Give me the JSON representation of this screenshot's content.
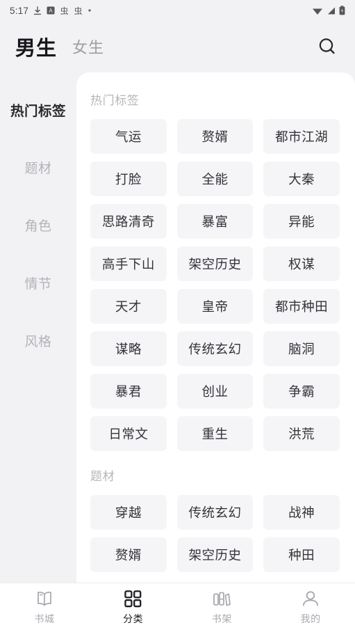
{
  "statusbar": {
    "time": "5:17",
    "left_icons": [
      "download-icon",
      "app-badge-icon",
      "app-glyph-icon",
      "app-glyph-icon",
      "dot-icon"
    ],
    "right_icons": [
      "wifi-icon",
      "signal-icon",
      "battery-icon"
    ]
  },
  "header": {
    "tab_male": "男生",
    "tab_female": "女生",
    "search_icon": "search-icon"
  },
  "sidebar": {
    "items": [
      {
        "label": "热门标签",
        "active": true
      },
      {
        "label": "题材",
        "active": false
      },
      {
        "label": "角色",
        "active": false
      },
      {
        "label": "情节",
        "active": false
      },
      {
        "label": "风格",
        "active": false
      }
    ]
  },
  "content": {
    "sections": [
      {
        "title": "热门标签",
        "tags": [
          "气运",
          "赘婿",
          "都市江湖",
          "打脸",
          "全能",
          "大秦",
          "思路清奇",
          "暴富",
          "异能",
          "高手下山",
          "架空历史",
          "权谋",
          "天才",
          "皇帝",
          "都市种田",
          "谋略",
          "传统玄幻",
          "脑洞",
          "暴君",
          "创业",
          "争霸",
          "日常文",
          "重生",
          "洪荒"
        ]
      },
      {
        "title": "题材",
        "tags": [
          "穿越",
          "传统玄幻",
          "战神",
          "赘婿",
          "架空历史",
          "种田"
        ]
      }
    ]
  },
  "bottomnav": {
    "items": [
      {
        "label": "书城",
        "icon": "open-book-icon",
        "active": false
      },
      {
        "label": "分类",
        "icon": "grid-icon",
        "active": true
      },
      {
        "label": "书架",
        "icon": "bookshelf-icon",
        "active": false
      },
      {
        "label": "我的",
        "icon": "person-icon",
        "active": false
      }
    ]
  },
  "colors": {
    "page_background": "#f2f2f4",
    "card_background": "#ffffff",
    "pill_background": "#f5f5f7",
    "active_text": "#1d1d22",
    "inactive_text": "#a9a9b0"
  }
}
